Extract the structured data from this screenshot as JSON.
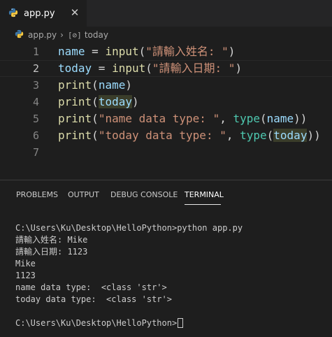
{
  "tab": {
    "label": "app.py",
    "close": "✕"
  },
  "breadcrumb": {
    "file": "app.py",
    "symbol": "today"
  },
  "editor": {
    "line_numbers": [
      "1",
      "2",
      "3",
      "4",
      "5",
      "6",
      "7"
    ],
    "lines": [
      [
        {
          "t": "name",
          "c": "var"
        },
        {
          "t": " = ",
          "c": "op"
        },
        {
          "t": "input",
          "c": "fn2"
        },
        {
          "t": "(",
          "c": "pun"
        },
        {
          "t": "\"請輸入姓名: \"",
          "c": "str"
        },
        {
          "t": ")",
          "c": "pun"
        }
      ],
      [
        {
          "t": "today",
          "c": "var"
        },
        {
          "t": " = ",
          "c": "op"
        },
        {
          "t": "input",
          "c": "fn2"
        },
        {
          "t": "(",
          "c": "pun"
        },
        {
          "t": "\"請輸入日期: \"",
          "c": "str"
        },
        {
          "t": ")",
          "c": "pun"
        }
      ],
      [
        {
          "t": "print",
          "c": "fn2"
        },
        {
          "t": "(",
          "c": "pun"
        },
        {
          "t": "name",
          "c": "var"
        },
        {
          "t": ")",
          "c": "pun"
        }
      ],
      [
        {
          "t": "print",
          "c": "fn2"
        },
        {
          "t": "(",
          "c": "pun"
        },
        {
          "t": "today",
          "c": "var hl"
        },
        {
          "t": ")",
          "c": "pun"
        }
      ],
      [
        {
          "t": "print",
          "c": "fn2"
        },
        {
          "t": "(",
          "c": "pun"
        },
        {
          "t": "\"name data type: \"",
          "c": "str"
        },
        {
          "t": ", ",
          "c": "pun"
        },
        {
          "t": "type",
          "c": "fn"
        },
        {
          "t": "(",
          "c": "pun"
        },
        {
          "t": "name",
          "c": "var"
        },
        {
          "t": "))",
          "c": "pun"
        }
      ],
      [
        {
          "t": "print",
          "c": "fn2"
        },
        {
          "t": "(",
          "c": "pun"
        },
        {
          "t": "\"today data type: \"",
          "c": "str"
        },
        {
          "t": ", ",
          "c": "pun"
        },
        {
          "t": "type",
          "c": "fn"
        },
        {
          "t": "(",
          "c": "pun"
        },
        {
          "t": "today",
          "c": "var hl"
        },
        {
          "t": "))",
          "c": "pun"
        }
      ],
      []
    ],
    "current_line": 2
  },
  "panel": {
    "tabs": [
      "PROBLEMS",
      "OUTPUT",
      "DEBUG CONSOLE",
      "TERMINAL"
    ],
    "active_tab": "TERMINAL",
    "terminal_lines": [
      "C:\\Users\\Ku\\Desktop\\HelloPython>python app.py",
      "請輸入姓名: Mike",
      "請輸入日期: 1123",
      "Mike",
      "1123",
      "name data type:  <class 'str'>",
      "today data type:  <class 'str'>",
      "",
      "C:\\Users\\Ku\\Desktop\\HelloPython>"
    ]
  },
  "colors": {
    "background": "#1e1e1e",
    "tabbar": "#252526",
    "string": "#ce9178",
    "variable": "#9cdcfe",
    "function": "#dcdcaa",
    "builtin": "#4ec9b0"
  }
}
